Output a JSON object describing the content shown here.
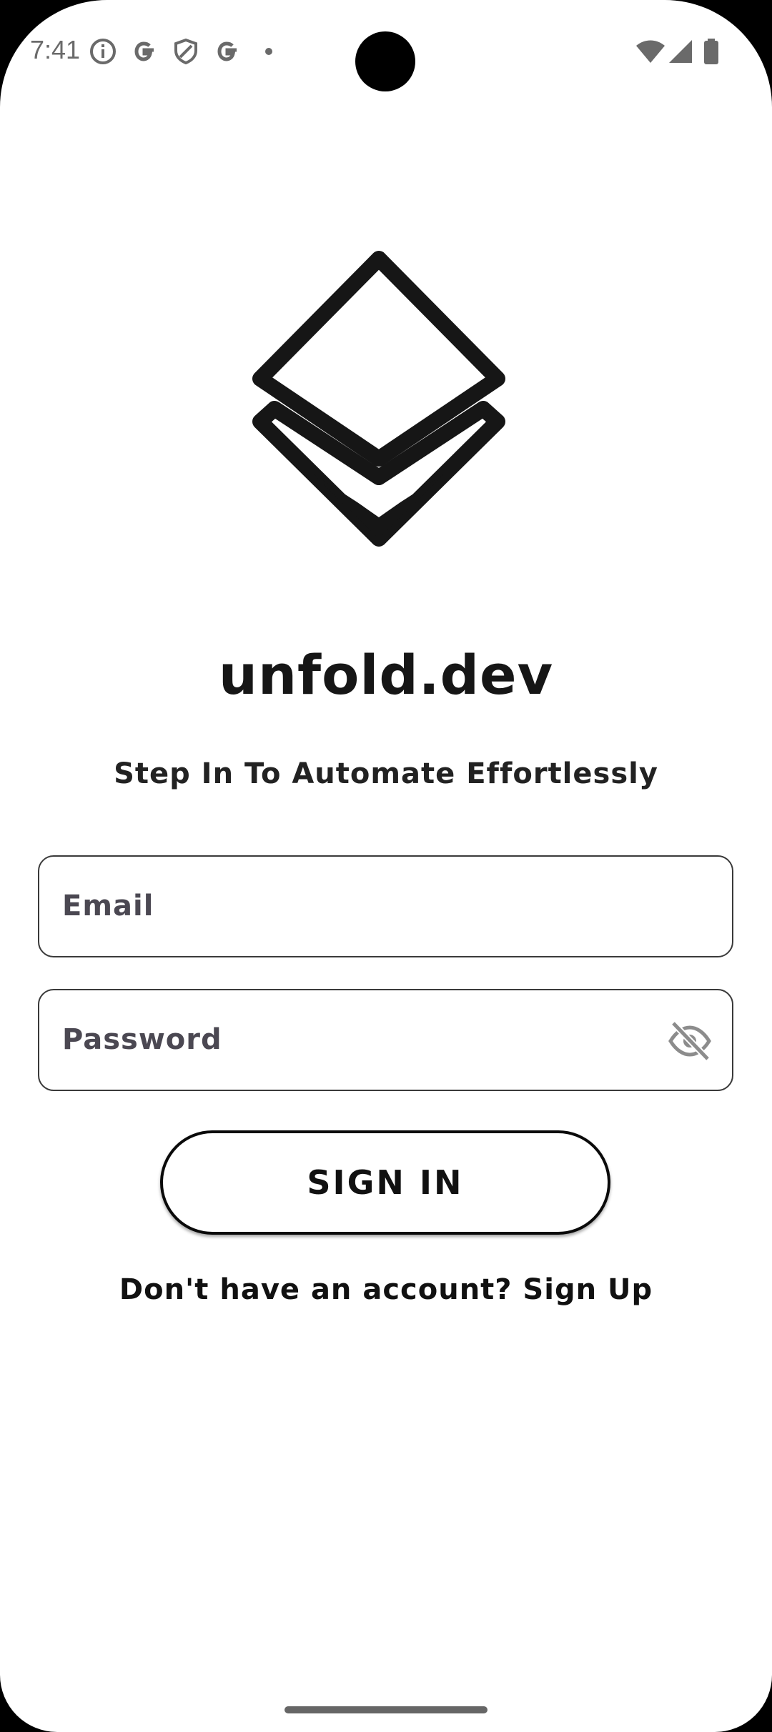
{
  "status_bar": {
    "time": "7:41",
    "left_icons": [
      "info-icon",
      "google-icon",
      "shield-icon",
      "google-icon",
      "dot-icon"
    ],
    "right_icons": [
      "wifi-icon",
      "signal-icon",
      "battery-icon"
    ]
  },
  "app": {
    "logo": "layered-diamond-logo",
    "title": "unfold.dev",
    "tagline": "Step In To Automate Effortlessly"
  },
  "form": {
    "email_placeholder": "Email",
    "password_placeholder": "Password",
    "password_toggle_icon": "eye-off-icon",
    "submit_label": "SIGN IN",
    "signup_prompt": "Don't have an account? Sign Up"
  }
}
